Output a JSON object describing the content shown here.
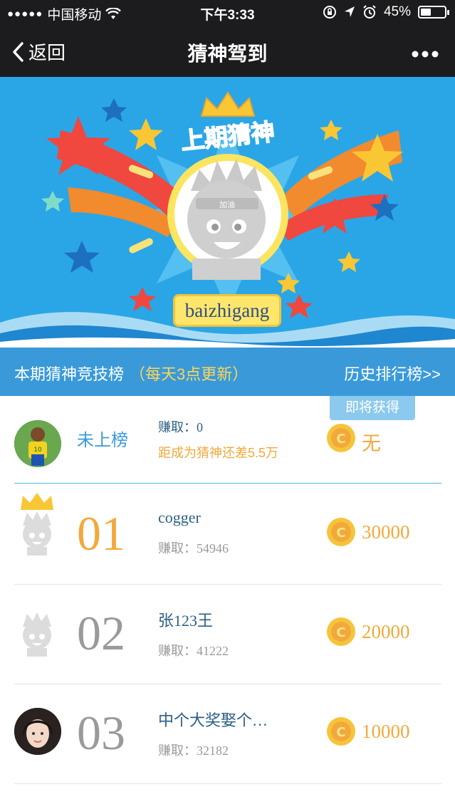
{
  "status_bar": {
    "carrier": "中国移动",
    "time": "下午3:33",
    "battery": "45%",
    "battery_level": 0.45
  },
  "nav": {
    "back_label": "返回",
    "title": "猜神驾到"
  },
  "banner": {
    "heading": "上期猜神",
    "avatar_badge": "加油",
    "username": "baizhigang"
  },
  "section": {
    "title": "本期猜神竞技榜",
    "note": "（每天3点更新）",
    "history_link": "历史排行榜>>"
  },
  "my_entry": {
    "status": "未上榜",
    "earned": "赚取：0",
    "gap": "距成为猜神还差5.5万",
    "soon_label": "即将获得",
    "reward": "无"
  },
  "leaderboard": [
    {
      "rank": "01",
      "name": "cogger",
      "earned": "赚取：54946",
      "reward": "30000"
    },
    {
      "rank": "02",
      "name": "张123王",
      "earned": "赚取：41222",
      "reward": "20000"
    },
    {
      "rank": "03",
      "name": "中个大奖娶个…",
      "earned": "赚取：32182",
      "reward": "10000"
    }
  ],
  "colors": {
    "nav_bg": "#1c1c1e",
    "banner_bg": "#2aa6e6",
    "section_bg": "#3a9ad9",
    "accent_gold": "#f2a93b",
    "name_blue": "#2b5f86"
  }
}
